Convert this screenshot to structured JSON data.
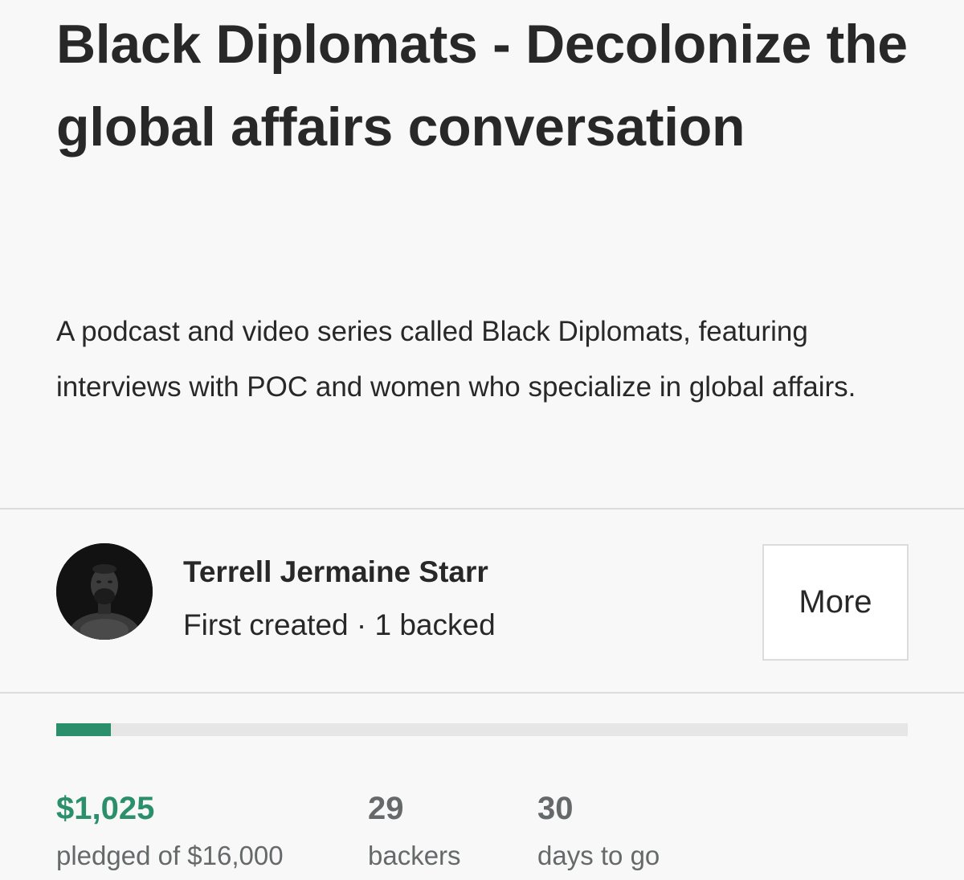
{
  "project": {
    "title": "Black Diplomats - Decolonize the global affairs conversation",
    "blurb": "A podcast and video series called Black Diplomats, featuring interviews with POC and women who specialize in global affairs."
  },
  "creator": {
    "name": "Terrell Jermaine Starr",
    "meta": "First created · 1 backed",
    "more_label": "More"
  },
  "funding": {
    "progress_fraction": 0.064,
    "pledged_amount": "$1,025",
    "pledged_label": "pledged of $16,000",
    "backers_count": "29",
    "backers_label": "backers",
    "days_count": "30",
    "days_label": "days to go"
  },
  "colors": {
    "accent_green": "#2a8f6a",
    "text_dark": "#282828",
    "text_gray": "#656969",
    "background": "#f8f8f8",
    "divider": "#dcdcdc"
  }
}
